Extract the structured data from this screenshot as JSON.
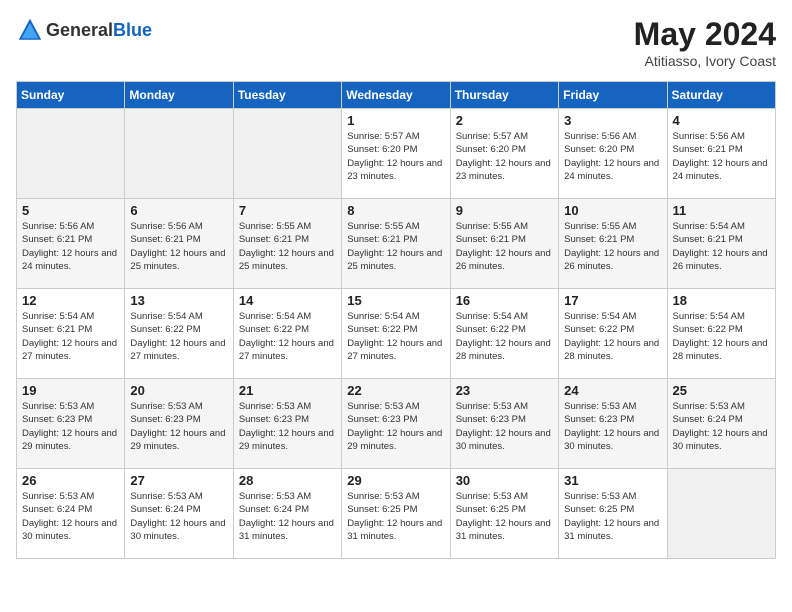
{
  "header": {
    "logo_general": "General",
    "logo_blue": "Blue",
    "month_year": "May 2024",
    "location": "Atitiasso, Ivory Coast"
  },
  "calendar": {
    "weekdays": [
      "Sunday",
      "Monday",
      "Tuesday",
      "Wednesday",
      "Thursday",
      "Friday",
      "Saturday"
    ],
    "weeks": [
      [
        {
          "day": "",
          "sunrise": "",
          "sunset": "",
          "daylight": ""
        },
        {
          "day": "",
          "sunrise": "",
          "sunset": "",
          "daylight": ""
        },
        {
          "day": "",
          "sunrise": "",
          "sunset": "",
          "daylight": ""
        },
        {
          "day": "1",
          "sunrise": "Sunrise: 5:57 AM",
          "sunset": "Sunset: 6:20 PM",
          "daylight": "Daylight: 12 hours and 23 minutes."
        },
        {
          "day": "2",
          "sunrise": "Sunrise: 5:57 AM",
          "sunset": "Sunset: 6:20 PM",
          "daylight": "Daylight: 12 hours and 23 minutes."
        },
        {
          "day": "3",
          "sunrise": "Sunrise: 5:56 AM",
          "sunset": "Sunset: 6:20 PM",
          "daylight": "Daylight: 12 hours and 24 minutes."
        },
        {
          "day": "4",
          "sunrise": "Sunrise: 5:56 AM",
          "sunset": "Sunset: 6:21 PM",
          "daylight": "Daylight: 12 hours and 24 minutes."
        }
      ],
      [
        {
          "day": "5",
          "sunrise": "Sunrise: 5:56 AM",
          "sunset": "Sunset: 6:21 PM",
          "daylight": "Daylight: 12 hours and 24 minutes."
        },
        {
          "day": "6",
          "sunrise": "Sunrise: 5:56 AM",
          "sunset": "Sunset: 6:21 PM",
          "daylight": "Daylight: 12 hours and 25 minutes."
        },
        {
          "day": "7",
          "sunrise": "Sunrise: 5:55 AM",
          "sunset": "Sunset: 6:21 PM",
          "daylight": "Daylight: 12 hours and 25 minutes."
        },
        {
          "day": "8",
          "sunrise": "Sunrise: 5:55 AM",
          "sunset": "Sunset: 6:21 PM",
          "daylight": "Daylight: 12 hours and 25 minutes."
        },
        {
          "day": "9",
          "sunrise": "Sunrise: 5:55 AM",
          "sunset": "Sunset: 6:21 PM",
          "daylight": "Daylight: 12 hours and 26 minutes."
        },
        {
          "day": "10",
          "sunrise": "Sunrise: 5:55 AM",
          "sunset": "Sunset: 6:21 PM",
          "daylight": "Daylight: 12 hours and 26 minutes."
        },
        {
          "day": "11",
          "sunrise": "Sunrise: 5:54 AM",
          "sunset": "Sunset: 6:21 PM",
          "daylight": "Daylight: 12 hours and 26 minutes."
        }
      ],
      [
        {
          "day": "12",
          "sunrise": "Sunrise: 5:54 AM",
          "sunset": "Sunset: 6:21 PM",
          "daylight": "Daylight: 12 hours and 27 minutes."
        },
        {
          "day": "13",
          "sunrise": "Sunrise: 5:54 AM",
          "sunset": "Sunset: 6:22 PM",
          "daylight": "Daylight: 12 hours and 27 minutes."
        },
        {
          "day": "14",
          "sunrise": "Sunrise: 5:54 AM",
          "sunset": "Sunset: 6:22 PM",
          "daylight": "Daylight: 12 hours and 27 minutes."
        },
        {
          "day": "15",
          "sunrise": "Sunrise: 5:54 AM",
          "sunset": "Sunset: 6:22 PM",
          "daylight": "Daylight: 12 hours and 27 minutes."
        },
        {
          "day": "16",
          "sunrise": "Sunrise: 5:54 AM",
          "sunset": "Sunset: 6:22 PM",
          "daylight": "Daylight: 12 hours and 28 minutes."
        },
        {
          "day": "17",
          "sunrise": "Sunrise: 5:54 AM",
          "sunset": "Sunset: 6:22 PM",
          "daylight": "Daylight: 12 hours and 28 minutes."
        },
        {
          "day": "18",
          "sunrise": "Sunrise: 5:54 AM",
          "sunset": "Sunset: 6:22 PM",
          "daylight": "Daylight: 12 hours and 28 minutes."
        }
      ],
      [
        {
          "day": "19",
          "sunrise": "Sunrise: 5:53 AM",
          "sunset": "Sunset: 6:23 PM",
          "daylight": "Daylight: 12 hours and 29 minutes."
        },
        {
          "day": "20",
          "sunrise": "Sunrise: 5:53 AM",
          "sunset": "Sunset: 6:23 PM",
          "daylight": "Daylight: 12 hours and 29 minutes."
        },
        {
          "day": "21",
          "sunrise": "Sunrise: 5:53 AM",
          "sunset": "Sunset: 6:23 PM",
          "daylight": "Daylight: 12 hours and 29 minutes."
        },
        {
          "day": "22",
          "sunrise": "Sunrise: 5:53 AM",
          "sunset": "Sunset: 6:23 PM",
          "daylight": "Daylight: 12 hours and 29 minutes."
        },
        {
          "day": "23",
          "sunrise": "Sunrise: 5:53 AM",
          "sunset": "Sunset: 6:23 PM",
          "daylight": "Daylight: 12 hours and 30 minutes."
        },
        {
          "day": "24",
          "sunrise": "Sunrise: 5:53 AM",
          "sunset": "Sunset: 6:23 PM",
          "daylight": "Daylight: 12 hours and 30 minutes."
        },
        {
          "day": "25",
          "sunrise": "Sunrise: 5:53 AM",
          "sunset": "Sunset: 6:24 PM",
          "daylight": "Daylight: 12 hours and 30 minutes."
        }
      ],
      [
        {
          "day": "26",
          "sunrise": "Sunrise: 5:53 AM",
          "sunset": "Sunset: 6:24 PM",
          "daylight": "Daylight: 12 hours and 30 minutes."
        },
        {
          "day": "27",
          "sunrise": "Sunrise: 5:53 AM",
          "sunset": "Sunset: 6:24 PM",
          "daylight": "Daylight: 12 hours and 30 minutes."
        },
        {
          "day": "28",
          "sunrise": "Sunrise: 5:53 AM",
          "sunset": "Sunset: 6:24 PM",
          "daylight": "Daylight: 12 hours and 31 minutes."
        },
        {
          "day": "29",
          "sunrise": "Sunrise: 5:53 AM",
          "sunset": "Sunset: 6:25 PM",
          "daylight": "Daylight: 12 hours and 31 minutes."
        },
        {
          "day": "30",
          "sunrise": "Sunrise: 5:53 AM",
          "sunset": "Sunset: 6:25 PM",
          "daylight": "Daylight: 12 hours and 31 minutes."
        },
        {
          "day": "31",
          "sunrise": "Sunrise: 5:53 AM",
          "sunset": "Sunset: 6:25 PM",
          "daylight": "Daylight: 12 hours and 31 minutes."
        },
        {
          "day": "",
          "sunrise": "",
          "sunset": "",
          "daylight": ""
        }
      ]
    ]
  }
}
